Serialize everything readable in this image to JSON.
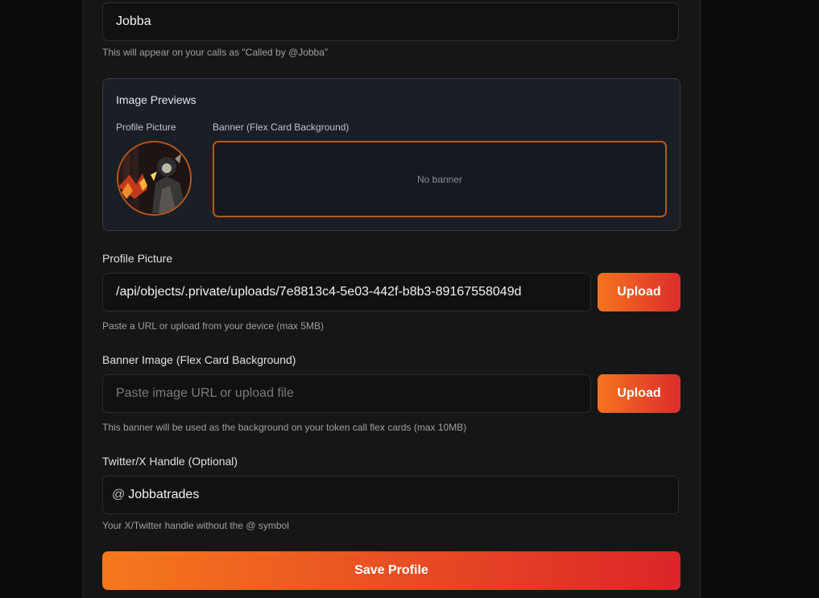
{
  "display_name": {
    "value": "Jobba",
    "hint": "This will appear on your calls as \"Called by @Jobba\""
  },
  "previews": {
    "title": "Image Previews",
    "profile_label": "Profile Picture",
    "banner_label": "Banner (Flex Card Background)",
    "banner_empty": "No banner",
    "accent": "#b8571d"
  },
  "profile_picture": {
    "label": "Profile Picture",
    "value": "/api/objects/.private/uploads/7e8813c4-5e03-442f-b8b3-89167558049d",
    "upload_label": "Upload",
    "hint": "Paste a URL or upload from your device (max 5MB)"
  },
  "banner_image": {
    "label": "Banner Image (Flex Card Background)",
    "placeholder": "Paste image URL or upload file",
    "upload_label": "Upload",
    "hint": "This banner will be used as the background on your token call flex cards (max 10MB)"
  },
  "twitter": {
    "label": "Twitter/X Handle (Optional)",
    "prefix": "@",
    "value": "Jobbatrades",
    "hint": "Your X/Twitter handle without the @ symbol"
  },
  "save_label": "Save Profile",
  "colors": {
    "gradient_start": "#f5741f",
    "gradient_end": "#dc2c2c"
  }
}
